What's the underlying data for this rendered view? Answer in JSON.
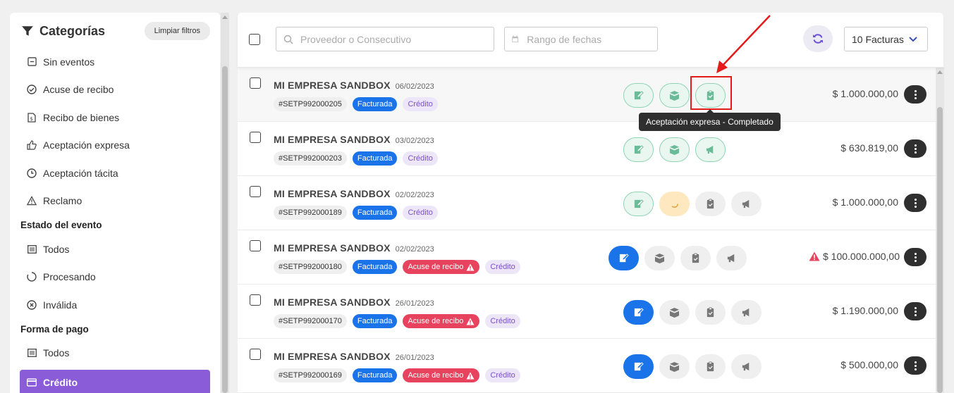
{
  "sidebar": {
    "title": "Categorías",
    "clear_filters": "Limpiar filtros",
    "events": [
      {
        "label": "Sin eventos",
        "icon": "minus-square-icon"
      },
      {
        "label": "Acuse de recibo",
        "icon": "check-circle-icon"
      },
      {
        "label": "Recibo de bienes",
        "icon": "receipt-icon"
      },
      {
        "label": "Aceptación expresa",
        "icon": "thumbs-up-icon"
      },
      {
        "label": "Aceptación tácita",
        "icon": "clock-icon"
      },
      {
        "label": "Reclamo",
        "icon": "warning-icon"
      }
    ],
    "section_estado": "Estado del evento",
    "estado": [
      {
        "label": "Todos",
        "icon": "list-icon"
      },
      {
        "label": "Procesando",
        "icon": "spinner-icon"
      },
      {
        "label": "Inválida",
        "icon": "x-circle-icon"
      }
    ],
    "section_pago": "Forma de pago",
    "pago": [
      {
        "label": "Todos",
        "icon": "list-icon"
      },
      {
        "label": "Crédito",
        "icon": "credit-card-icon",
        "active": true
      }
    ]
  },
  "toolbar": {
    "search_placeholder": "Proveedor o Consecutivo",
    "dates_placeholder": "Rango de fechas",
    "count_label": "10 Facturas"
  },
  "tooltip": "Aceptación expresa - Completado",
  "rows": [
    {
      "company": "MI EMPRESA SANDBOX",
      "date": "06/02/2023",
      "id": "#SETP992000205",
      "type": "Facturada",
      "acuse": "",
      "pay": "Crédito",
      "amount": "$ 1.000.000,00"
    },
    {
      "company": "MI EMPRESA SANDBOX",
      "date": "03/02/2023",
      "id": "#SETP992000203",
      "type": "Facturada",
      "acuse": "",
      "pay": "Crédito",
      "amount": "$ 630.819,00"
    },
    {
      "company": "MI EMPRESA SANDBOX",
      "date": "02/02/2023",
      "id": "#SETP992000189",
      "type": "Facturada",
      "acuse": "",
      "pay": "Crédito",
      "amount": "$ 1.000.000,00"
    },
    {
      "company": "MI EMPRESA SANDBOX",
      "date": "02/02/2023",
      "id": "#SETP992000180",
      "type": "Facturada",
      "acuse": "Acuse de recibo",
      "pay": "Crédito",
      "amount": "$ 100.000.000,00"
    },
    {
      "company": "MI EMPRESA SANDBOX",
      "date": "26/01/2023",
      "id": "#SETP992000170",
      "type": "Facturada",
      "acuse": "Acuse de recibo",
      "pay": "Crédito",
      "amount": "$ 1.190.000,00"
    },
    {
      "company": "MI EMPRESA SANDBOX",
      "date": "26/01/2023",
      "id": "#SETP992000169",
      "type": "Facturada",
      "acuse": "Acuse de recibo",
      "pay": "Crédito",
      "amount": "$ 500.000,00"
    }
  ],
  "colors": {
    "accent": "#8b5cd8",
    "primary": "#1a73e8",
    "danger": "#e8435e",
    "success": "#6abb97"
  }
}
